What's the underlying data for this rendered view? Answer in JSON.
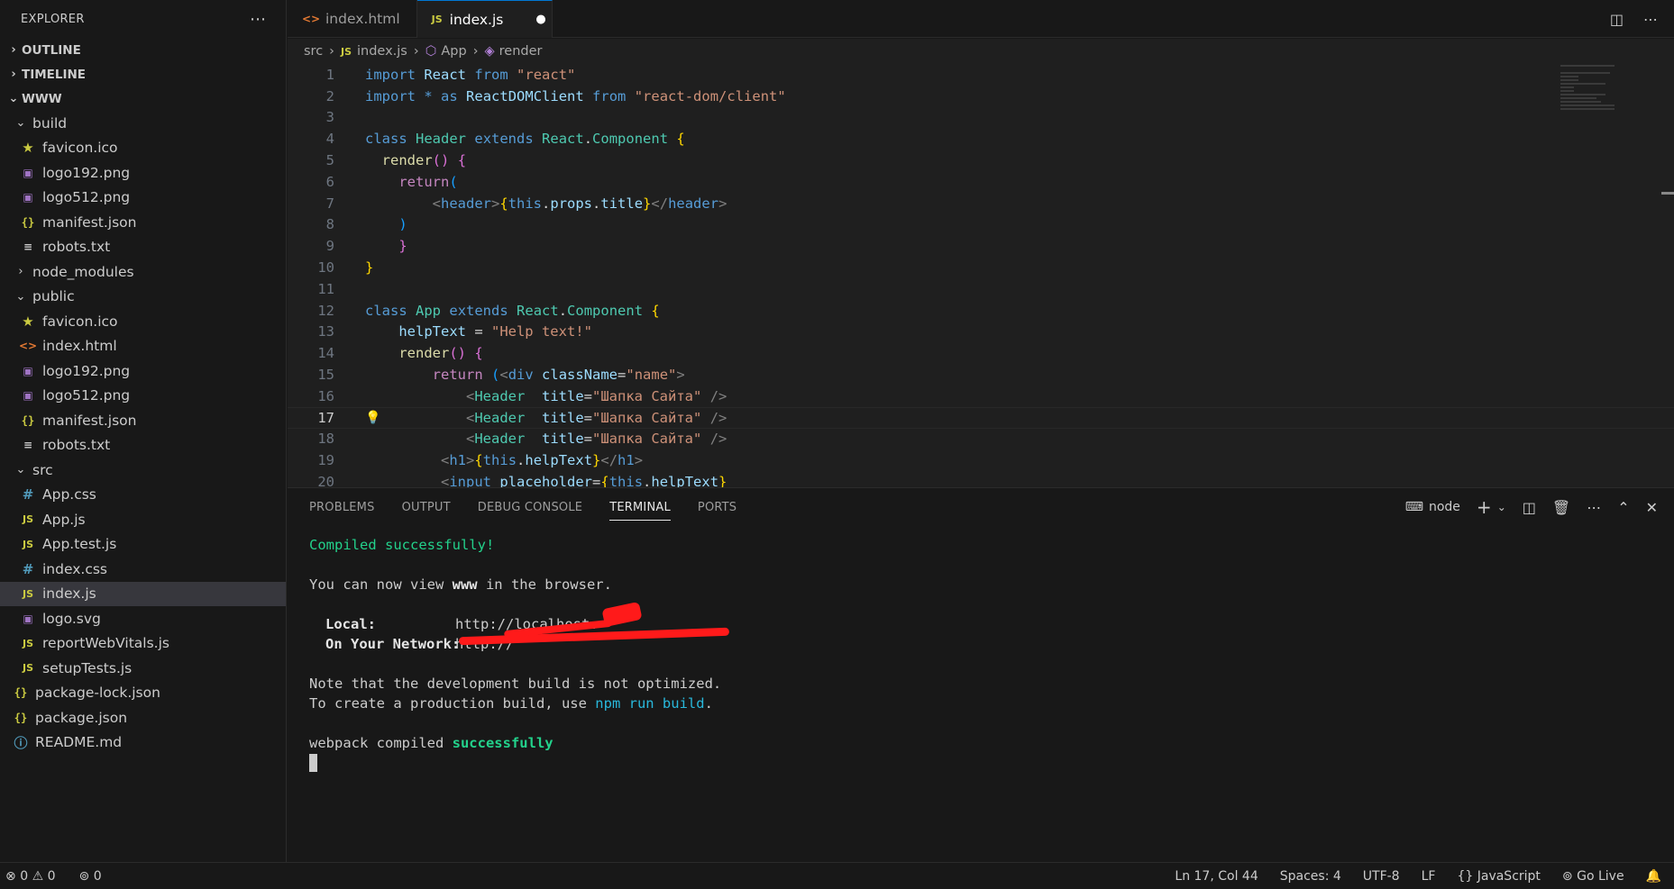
{
  "sidebar": {
    "title": "EXPLORER",
    "more": "⋯",
    "sections": {
      "outline": "OUTLINE",
      "timeline": "TIMELINE",
      "root": "WWW"
    },
    "tree": [
      {
        "label": "build",
        "type": "folder",
        "depth": 1,
        "expanded": true,
        "icon": "chevron-down-icon"
      },
      {
        "label": "favicon.ico",
        "type": "file",
        "depth": 2,
        "icon": "star-icon"
      },
      {
        "label": "logo192.png",
        "type": "file",
        "depth": 2,
        "icon": "image-icon"
      },
      {
        "label": "logo512.png",
        "type": "file",
        "depth": 2,
        "icon": "image-icon"
      },
      {
        "label": "manifest.json",
        "type": "file",
        "depth": 2,
        "icon": "json-icon"
      },
      {
        "label": "robots.txt",
        "type": "file",
        "depth": 2,
        "icon": "text-file-icon"
      },
      {
        "label": "node_modules",
        "type": "folder",
        "depth": 1,
        "expanded": false,
        "icon": "chevron-right-icon"
      },
      {
        "label": "public",
        "type": "folder",
        "depth": 1,
        "expanded": true,
        "icon": "chevron-down-icon"
      },
      {
        "label": "favicon.ico",
        "type": "file",
        "depth": 2,
        "icon": "star-icon"
      },
      {
        "label": "index.html",
        "type": "file",
        "depth": 2,
        "icon": "html-icon"
      },
      {
        "label": "logo192.png",
        "type": "file",
        "depth": 2,
        "icon": "image-icon"
      },
      {
        "label": "logo512.png",
        "type": "file",
        "depth": 2,
        "icon": "image-icon"
      },
      {
        "label": "manifest.json",
        "type": "file",
        "depth": 2,
        "icon": "json-icon"
      },
      {
        "label": "robots.txt",
        "type": "file",
        "depth": 2,
        "icon": "text-file-icon"
      },
      {
        "label": "src",
        "type": "folder",
        "depth": 1,
        "expanded": true,
        "icon": "chevron-down-icon"
      },
      {
        "label": "App.css",
        "type": "file",
        "depth": 2,
        "icon": "css-icon"
      },
      {
        "label": "App.js",
        "type": "file",
        "depth": 2,
        "icon": "js-icon"
      },
      {
        "label": "App.test.js",
        "type": "file",
        "depth": 2,
        "icon": "js-icon"
      },
      {
        "label": "index.css",
        "type": "file",
        "depth": 2,
        "icon": "css-icon"
      },
      {
        "label": "index.js",
        "type": "file",
        "depth": 2,
        "icon": "js-icon",
        "selected": true
      },
      {
        "label": "logo.svg",
        "type": "file",
        "depth": 2,
        "icon": "svg-icon"
      },
      {
        "label": "reportWebVitals.js",
        "type": "file",
        "depth": 2,
        "icon": "js-icon"
      },
      {
        "label": "setupTests.js",
        "type": "file",
        "depth": 2,
        "icon": "js-icon"
      },
      {
        "label": "package-lock.json",
        "type": "file",
        "depth": 1,
        "icon": "json-icon"
      },
      {
        "label": "package.json",
        "type": "file",
        "depth": 1,
        "icon": "json-icon"
      },
      {
        "label": "README.md",
        "type": "file",
        "depth": 1,
        "icon": "info-icon"
      }
    ]
  },
  "tabs": [
    {
      "label": "index.html",
      "icon": "html-icon",
      "active": false
    },
    {
      "label": "index.js",
      "icon": "js-icon",
      "active": true,
      "dirty": "●"
    }
  ],
  "breadcrumb": {
    "folder": "src",
    "file": "index.js",
    "class": "App",
    "method": "render",
    "sep": "›"
  },
  "editor": {
    "lines": [
      {
        "n": "1",
        "tokens": [
          [
            "kw",
            "import"
          ],
          [
            "txt",
            " "
          ],
          [
            "var",
            "React"
          ],
          [
            "txt",
            " "
          ],
          [
            "kw",
            "from"
          ],
          [
            "txt",
            " "
          ],
          [
            "str",
            "\"react\""
          ]
        ]
      },
      {
        "n": "2",
        "tokens": [
          [
            "kw",
            "import"
          ],
          [
            "txt",
            " "
          ],
          [
            "kw",
            "*"
          ],
          [
            "txt",
            " "
          ],
          [
            "kw",
            "as"
          ],
          [
            "txt",
            " "
          ],
          [
            "var",
            "ReactDOMClient"
          ],
          [
            "txt",
            " "
          ],
          [
            "kw",
            "from"
          ],
          [
            "txt",
            " "
          ],
          [
            "str",
            "\"react-dom/client\""
          ]
        ]
      },
      {
        "n": "3",
        "tokens": []
      },
      {
        "n": "4",
        "tokens": [
          [
            "kw",
            "class"
          ],
          [
            "txt",
            " "
          ],
          [
            "cls",
            "Header"
          ],
          [
            "txt",
            " "
          ],
          [
            "kw",
            "extends"
          ],
          [
            "txt",
            " "
          ],
          [
            "cls",
            "React"
          ],
          [
            "txt",
            "."
          ],
          [
            "cls",
            "Component"
          ],
          [
            "txt",
            " "
          ],
          [
            "br1",
            "{"
          ]
        ]
      },
      {
        "n": "5",
        "tokens": [
          [
            "txt",
            "  "
          ],
          [
            "fn",
            "render"
          ],
          [
            "br2",
            "()"
          ],
          [
            "txt",
            " "
          ],
          [
            "br2",
            "{"
          ]
        ]
      },
      {
        "n": "6",
        "tokens": [
          [
            "txt",
            "    "
          ],
          [
            "ctl",
            "return"
          ],
          [
            "br3",
            "("
          ]
        ]
      },
      {
        "n": "7",
        "tokens": [
          [
            "txt",
            "        "
          ],
          [
            "tagp",
            "<"
          ],
          [
            "tag",
            "header"
          ],
          [
            "tagp",
            ">"
          ],
          [
            "br1",
            "{"
          ],
          [
            "kw",
            "this"
          ],
          [
            "txt",
            "."
          ],
          [
            "var",
            "props"
          ],
          [
            "txt",
            "."
          ],
          [
            "var",
            "title"
          ],
          [
            "br1",
            "}"
          ],
          [
            "tagp",
            "</"
          ],
          [
            "tag",
            "header"
          ],
          [
            "tagp",
            ">"
          ]
        ]
      },
      {
        "n": "8",
        "tokens": [
          [
            "txt",
            "    "
          ],
          [
            "br3",
            ")"
          ]
        ]
      },
      {
        "n": "9",
        "tokens": [
          [
            "txt",
            "    "
          ],
          [
            "br2",
            "}"
          ]
        ]
      },
      {
        "n": "10",
        "tokens": [
          [
            "br1",
            "}"
          ]
        ]
      },
      {
        "n": "11",
        "tokens": []
      },
      {
        "n": "12",
        "tokens": [
          [
            "kw",
            "class"
          ],
          [
            "txt",
            " "
          ],
          [
            "cls",
            "App"
          ],
          [
            "txt",
            " "
          ],
          [
            "kw",
            "extends"
          ],
          [
            "txt",
            " "
          ],
          [
            "cls",
            "React"
          ],
          [
            "txt",
            "."
          ],
          [
            "cls",
            "Component"
          ],
          [
            "txt",
            " "
          ],
          [
            "br1",
            "{"
          ]
        ]
      },
      {
        "n": "13",
        "tokens": [
          [
            "txt",
            "    "
          ],
          [
            "var",
            "helpText"
          ],
          [
            "txt",
            " = "
          ],
          [
            "str",
            "\"Help text!\""
          ]
        ]
      },
      {
        "n": "14",
        "tokens": [
          [
            "txt",
            "    "
          ],
          [
            "fn",
            "render"
          ],
          [
            "br2",
            "()"
          ],
          [
            "txt",
            " "
          ],
          [
            "br2",
            "{"
          ]
        ]
      },
      {
        "n": "15",
        "tokens": [
          [
            "txt",
            "        "
          ],
          [
            "ctl",
            "return"
          ],
          [
            "txt",
            " "
          ],
          [
            "br3",
            "("
          ],
          [
            "tagp",
            "<"
          ],
          [
            "tag",
            "div"
          ],
          [
            "txt",
            " "
          ],
          [
            "attr",
            "className"
          ],
          [
            "txt",
            "="
          ],
          [
            "str",
            "\"name\""
          ],
          [
            "tagp",
            ">"
          ]
        ]
      },
      {
        "n": "16",
        "tokens": [
          [
            "txt",
            "            "
          ],
          [
            "tagp",
            "<"
          ],
          [
            "cls",
            "Header"
          ],
          [
            "txt",
            "  "
          ],
          [
            "attr",
            "title"
          ],
          [
            "txt",
            "="
          ],
          [
            "str",
            "\"Шапка Сайта\""
          ],
          [
            "txt",
            " "
          ],
          [
            "tagp",
            "/>"
          ]
        ]
      },
      {
        "n": "17",
        "tokens": [
          [
            "txt",
            "            "
          ],
          [
            "tagp",
            "<"
          ],
          [
            "cls",
            "Header"
          ],
          [
            "txt",
            "  "
          ],
          [
            "attr",
            "title"
          ],
          [
            "txt",
            "="
          ],
          [
            "str",
            "\"Шапка Сайта\""
          ],
          [
            "txt",
            " "
          ],
          [
            "tagp",
            "/>"
          ]
        ],
        "current": true
      },
      {
        "n": "18",
        "tokens": [
          [
            "txt",
            "            "
          ],
          [
            "tagp",
            "<"
          ],
          [
            "cls",
            "Header"
          ],
          [
            "txt",
            "  "
          ],
          [
            "attr",
            "title"
          ],
          [
            "txt",
            "="
          ],
          [
            "str",
            "\"Шапка Сайта\""
          ],
          [
            "txt",
            " "
          ],
          [
            "tagp",
            "/>"
          ]
        ]
      },
      {
        "n": "19",
        "tokens": [
          [
            "txt",
            "         "
          ],
          [
            "tagp",
            "<"
          ],
          [
            "tag",
            "h1"
          ],
          [
            "tagp",
            ">"
          ],
          [
            "br1",
            "{"
          ],
          [
            "kw",
            "this"
          ],
          [
            "txt",
            "."
          ],
          [
            "var",
            "helpText"
          ],
          [
            "br1",
            "}"
          ],
          [
            "tagp",
            "</"
          ],
          [
            "tag",
            "h1"
          ],
          [
            "tagp",
            ">"
          ]
        ]
      },
      {
        "n": "20",
        "tokens": [
          [
            "txt",
            "         "
          ],
          [
            "tagp",
            "<"
          ],
          [
            "tag",
            "input"
          ],
          [
            "txt",
            " "
          ],
          [
            "attr",
            "placeholder"
          ],
          [
            "txt",
            "="
          ],
          [
            "br1",
            "{"
          ],
          [
            "kw",
            "this"
          ],
          [
            "txt",
            "."
          ],
          [
            "var",
            "helpText"
          ],
          [
            "br1",
            "}"
          ]
        ]
      }
    ]
  },
  "panel": {
    "tabs": [
      "PROBLEMS",
      "OUTPUT",
      "DEBUG CONSOLE",
      "TERMINAL",
      "PORTS"
    ],
    "active_tab": "TERMINAL",
    "terminal_name": "node",
    "terminal": {
      "compiled": "Compiled successfully!",
      "view_prefix": "You can now view ",
      "view_app": "www",
      "view_suffix": " in the browser.",
      "local_label": "Local:",
      "local_url": "http://localhost:",
      "network_label": "On Your Network:",
      "network_url": "http://",
      "note1": "Note that the development build is not optimized.",
      "note2_prefix": "To create a production build, use ",
      "note2_cmd": "npm run build",
      "note2_suffix": ".",
      "webpack_prefix": "webpack compiled ",
      "webpack_status": "successfully"
    }
  },
  "status": {
    "errors": "0",
    "warnings": "0",
    "ports": "0",
    "position": "Ln 17, Col 44",
    "spaces": "Spaces: 4",
    "encoding": "UTF-8",
    "eol": "LF",
    "language": "JavaScript",
    "golive": "Go Live"
  }
}
